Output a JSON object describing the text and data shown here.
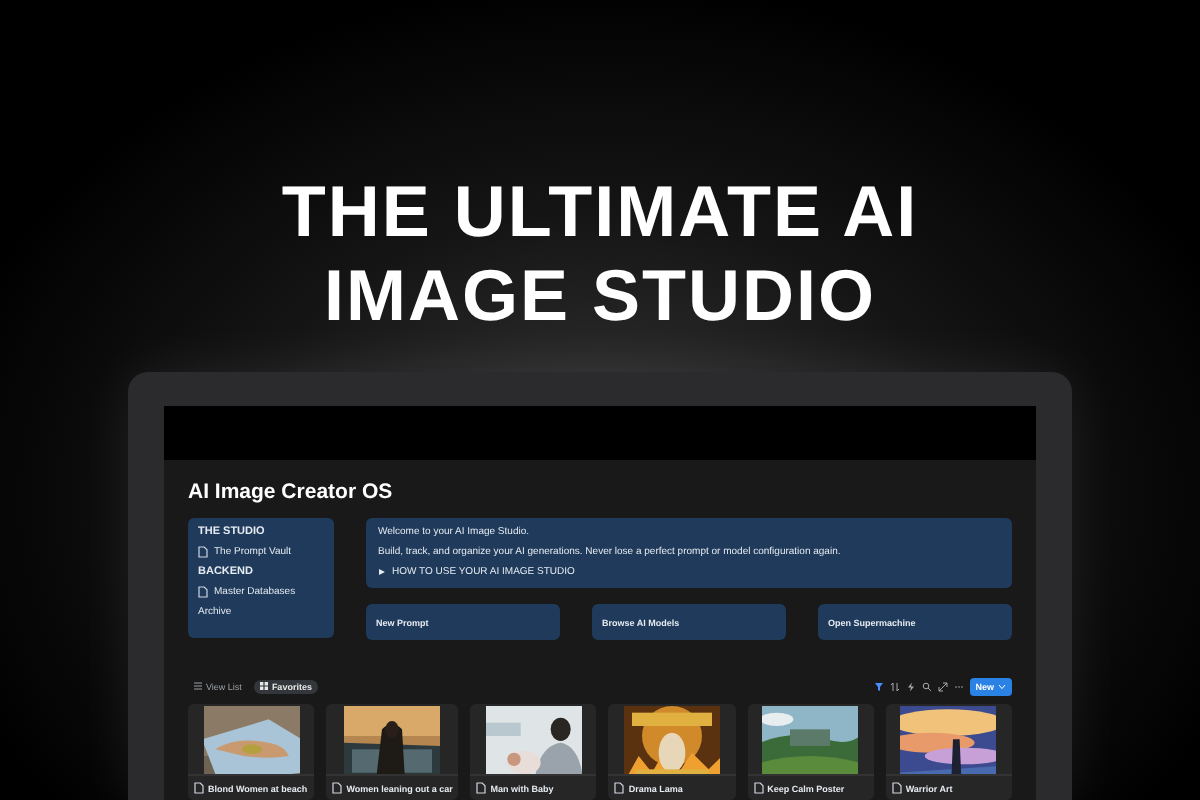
{
  "headline": "THE ULTIMATE AI IMAGE STUDIO",
  "page": {
    "title": "AI Image Creator OS"
  },
  "sidebar": {
    "sections": [
      {
        "heading": "THE STUDIO",
        "items": [
          {
            "label": "The Prompt Vault",
            "kind": "page"
          }
        ]
      },
      {
        "heading": "BACKEND",
        "items": [
          {
            "label": "Master Databases",
            "kind": "page"
          },
          {
            "label": "Archive",
            "kind": "plain"
          }
        ]
      }
    ]
  },
  "welcome": {
    "lines": [
      "Welcome to your AI Image Studio.",
      "Build, track, and organize your AI generations. Never lose a perfect prompt or model configuration again."
    ],
    "toggle": "HOW TO USE YOUR AI IMAGE STUDIO"
  },
  "actions": [
    "New Prompt",
    "Browse AI Models",
    "Open Supermachine"
  ],
  "views": [
    {
      "label": "View List",
      "selected": false
    },
    {
      "label": "Favorites",
      "selected": true
    }
  ],
  "new_button": "New",
  "gallery": [
    {
      "caption": "Blond Women at beach"
    },
    {
      "caption": "Women leaning out a car"
    },
    {
      "caption": "Man with Baby"
    },
    {
      "caption": "Drama Lama"
    },
    {
      "caption": "Keep Calm Poster"
    },
    {
      "caption": "Warrior Art"
    }
  ]
}
